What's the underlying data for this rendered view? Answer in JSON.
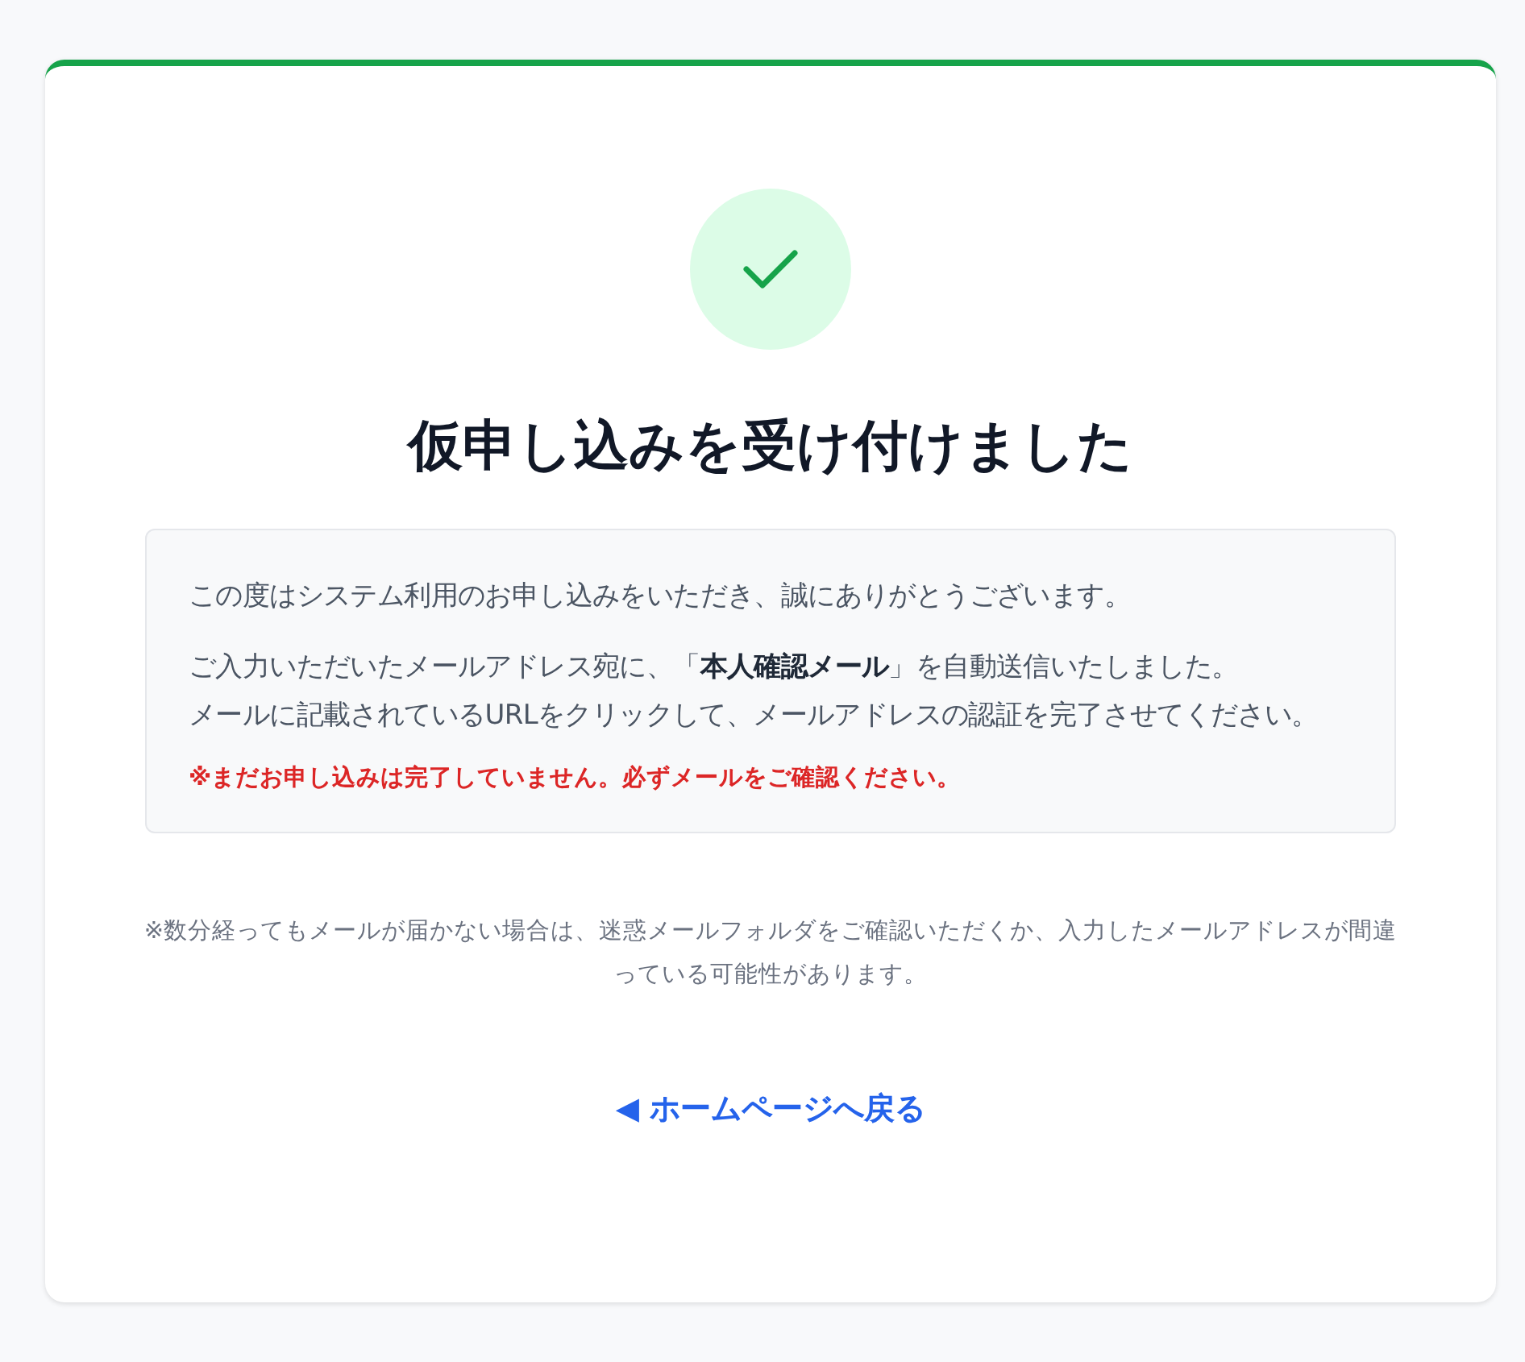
{
  "status_icon": {
    "kind": "check"
  },
  "title": "仮申し込みを受け付けました",
  "message_box": {
    "paragraphs": [
      {
        "lines": [
          "この度はシステム利用のお申し込みをいただき、誠にありがとうございます。"
        ]
      },
      {
        "lines": [
          "ご入力いただいたメールアドレス宛に、「**本人確認メール**」を自動送信いたしました。",
          "メールに記載されているURLをクリックして、メールアドレスの認証を完了させてください。"
        ]
      }
    ],
    "warning": "※まだお申し込みは完了していません。必ずメールをご確認ください。"
  },
  "note": "※数分経ってもメールが届かない場合は、迷惑メールフォルダをご確認いただくか、入力したメールアドレスが間違っている可能性があります。",
  "back_link": "◀ ホームページへ戻る"
}
